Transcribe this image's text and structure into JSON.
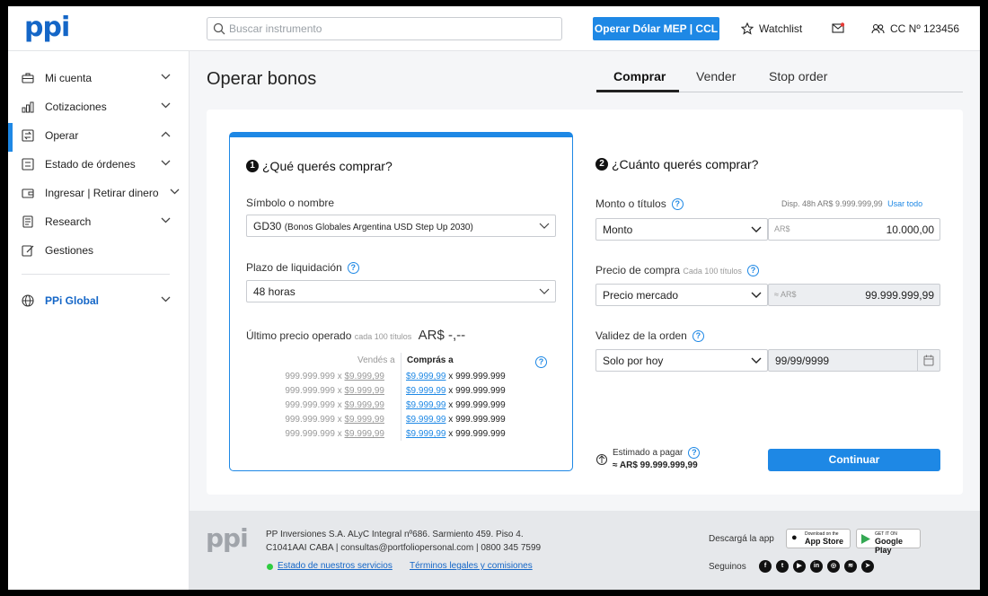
{
  "header": {
    "logo": "ppi",
    "search_placeholder": "Buscar instrumento",
    "mep_button": "Operar Dólar MEP | CCL",
    "watchlist": "Watchlist",
    "account": "CC Nº 123456"
  },
  "sidebar": {
    "items": [
      {
        "label": "Mi cuenta",
        "icon": "briefcase-icon"
      },
      {
        "label": "Cotizaciones",
        "icon": "chart-icon"
      },
      {
        "label": "Operar",
        "icon": "exchange-icon"
      },
      {
        "label": "Estado de órdenes",
        "icon": "list-icon"
      },
      {
        "label": "Ingresar | Retirar dinero",
        "icon": "wallet-icon"
      },
      {
        "label": "Research",
        "icon": "research-icon"
      },
      {
        "label": "Gestiones",
        "icon": "edit-icon"
      }
    ],
    "global": "PPi Global"
  },
  "main": {
    "title": "Operar bonos",
    "tabs": [
      "Comprar",
      "Vender",
      "Stop order"
    ]
  },
  "step1": {
    "badge": "1",
    "title": "¿Qué querés comprar?",
    "symbol_label": "Símbolo o nombre",
    "symbol_value": "GD30",
    "symbol_desc": "(Bonos Globales Argentina USD Step Up 2030)",
    "plazo_label": "Plazo de liquidación",
    "plazo_value": "48 horas",
    "last_price_label": "Último precio operado",
    "last_price_sub": "cada 100 títulos",
    "last_price_value": "AR$ -,--",
    "col_sell": "Vendés a",
    "col_buy": "Comprás a",
    "rows": [
      {
        "sell_qty": "999.999.999",
        "sell_price": "$9.999,99",
        "buy_price": "$9.999,99",
        "buy_qty": "999.999.999"
      },
      {
        "sell_qty": "999.999.999",
        "sell_price": "$9.999,99",
        "buy_price": "$9.999,99",
        "buy_qty": "999.999.999"
      },
      {
        "sell_qty": "999.999.999",
        "sell_price": "$9.999,99",
        "buy_price": "$9.999,99",
        "buy_qty": "999.999.999"
      },
      {
        "sell_qty": "999.999.999",
        "sell_price": "$9.999,99",
        "buy_price": "$9.999,99",
        "buy_qty": "999.999.999"
      },
      {
        "sell_qty": "999.999.999",
        "sell_price": "$9.999,99",
        "buy_price": "$9.999,99",
        "buy_qty": "999.999.999"
      }
    ],
    "x_sep": "x"
  },
  "step2": {
    "badge": "2",
    "title": "¿Cuánto querés comprar?",
    "monto_label": "Monto o títulos",
    "disp_text": "Disp. 48h AR$ 9.999.999,99",
    "usar_todo": "Usar todo",
    "monto_select": "Monto",
    "currency": "AR$",
    "monto_value": "10.000,00",
    "precio_label": "Precio de compra",
    "precio_sub": "Cada 100 títulos",
    "precio_select": "Precio mercado",
    "precio_prefix": "≈ AR$",
    "precio_value": "99.999.999,99",
    "validez_label": "Validez de la orden",
    "validez_select": "Solo por hoy",
    "date_value": "99/99/9999",
    "estimado_label": "Estimado a pagar",
    "estimado_value": "≈ AR$ 99.999.999,99",
    "continue": "Continuar"
  },
  "footer": {
    "logo": "ppi",
    "line1": "PP Inversiones S.A. ALyC Integral nº686. Sarmiento 459. Piso 4.",
    "line2": "C1041AAI CABA  |  consultas@portfoliopersonal.com  |  0800 345 7599",
    "status_link": "Estado de nuestros servicios",
    "terms_link": "Términos legales y comisiones",
    "download": "Descargá la app",
    "appstore_small": "Download on the",
    "appstore": "App Store",
    "googleplay_small": "GET IT ON",
    "googleplay": "Google Play",
    "follow": "Seguinos",
    "status_color": "#2ecc40"
  }
}
